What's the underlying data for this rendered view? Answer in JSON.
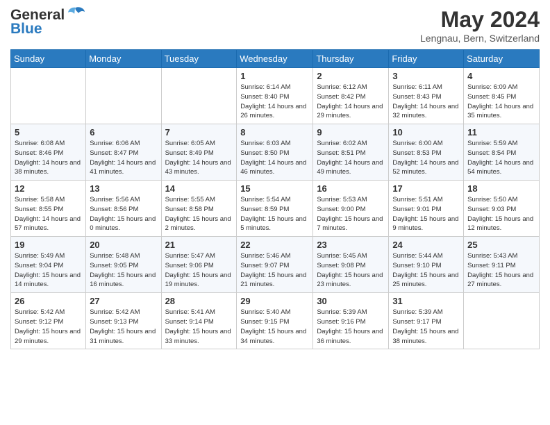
{
  "header": {
    "logo_general": "General",
    "logo_blue": "Blue",
    "month_title": "May 2024",
    "location": "Lengnau, Bern, Switzerland"
  },
  "days_of_week": [
    "Sunday",
    "Monday",
    "Tuesday",
    "Wednesday",
    "Thursday",
    "Friday",
    "Saturday"
  ],
  "weeks": [
    [
      {
        "day": "",
        "sunrise": "",
        "sunset": "",
        "daylight": ""
      },
      {
        "day": "",
        "sunrise": "",
        "sunset": "",
        "daylight": ""
      },
      {
        "day": "",
        "sunrise": "",
        "sunset": "",
        "daylight": ""
      },
      {
        "day": "1",
        "sunrise": "Sunrise: 6:14 AM",
        "sunset": "Sunset: 8:40 PM",
        "daylight": "Daylight: 14 hours and 26 minutes."
      },
      {
        "day": "2",
        "sunrise": "Sunrise: 6:12 AM",
        "sunset": "Sunset: 8:42 PM",
        "daylight": "Daylight: 14 hours and 29 minutes."
      },
      {
        "day": "3",
        "sunrise": "Sunrise: 6:11 AM",
        "sunset": "Sunset: 8:43 PM",
        "daylight": "Daylight: 14 hours and 32 minutes."
      },
      {
        "day": "4",
        "sunrise": "Sunrise: 6:09 AM",
        "sunset": "Sunset: 8:45 PM",
        "daylight": "Daylight: 14 hours and 35 minutes."
      }
    ],
    [
      {
        "day": "5",
        "sunrise": "Sunrise: 6:08 AM",
        "sunset": "Sunset: 8:46 PM",
        "daylight": "Daylight: 14 hours and 38 minutes."
      },
      {
        "day": "6",
        "sunrise": "Sunrise: 6:06 AM",
        "sunset": "Sunset: 8:47 PM",
        "daylight": "Daylight: 14 hours and 41 minutes."
      },
      {
        "day": "7",
        "sunrise": "Sunrise: 6:05 AM",
        "sunset": "Sunset: 8:49 PM",
        "daylight": "Daylight: 14 hours and 43 minutes."
      },
      {
        "day": "8",
        "sunrise": "Sunrise: 6:03 AM",
        "sunset": "Sunset: 8:50 PM",
        "daylight": "Daylight: 14 hours and 46 minutes."
      },
      {
        "day": "9",
        "sunrise": "Sunrise: 6:02 AM",
        "sunset": "Sunset: 8:51 PM",
        "daylight": "Daylight: 14 hours and 49 minutes."
      },
      {
        "day": "10",
        "sunrise": "Sunrise: 6:00 AM",
        "sunset": "Sunset: 8:53 PM",
        "daylight": "Daylight: 14 hours and 52 minutes."
      },
      {
        "day": "11",
        "sunrise": "Sunrise: 5:59 AM",
        "sunset": "Sunset: 8:54 PM",
        "daylight": "Daylight: 14 hours and 54 minutes."
      }
    ],
    [
      {
        "day": "12",
        "sunrise": "Sunrise: 5:58 AM",
        "sunset": "Sunset: 8:55 PM",
        "daylight": "Daylight: 14 hours and 57 minutes."
      },
      {
        "day": "13",
        "sunrise": "Sunrise: 5:56 AM",
        "sunset": "Sunset: 8:56 PM",
        "daylight": "Daylight: 15 hours and 0 minutes."
      },
      {
        "day": "14",
        "sunrise": "Sunrise: 5:55 AM",
        "sunset": "Sunset: 8:58 PM",
        "daylight": "Daylight: 15 hours and 2 minutes."
      },
      {
        "day": "15",
        "sunrise": "Sunrise: 5:54 AM",
        "sunset": "Sunset: 8:59 PM",
        "daylight": "Daylight: 15 hours and 5 minutes."
      },
      {
        "day": "16",
        "sunrise": "Sunrise: 5:53 AM",
        "sunset": "Sunset: 9:00 PM",
        "daylight": "Daylight: 15 hours and 7 minutes."
      },
      {
        "day": "17",
        "sunrise": "Sunrise: 5:51 AM",
        "sunset": "Sunset: 9:01 PM",
        "daylight": "Daylight: 15 hours and 9 minutes."
      },
      {
        "day": "18",
        "sunrise": "Sunrise: 5:50 AM",
        "sunset": "Sunset: 9:03 PM",
        "daylight": "Daylight: 15 hours and 12 minutes."
      }
    ],
    [
      {
        "day": "19",
        "sunrise": "Sunrise: 5:49 AM",
        "sunset": "Sunset: 9:04 PM",
        "daylight": "Daylight: 15 hours and 14 minutes."
      },
      {
        "day": "20",
        "sunrise": "Sunrise: 5:48 AM",
        "sunset": "Sunset: 9:05 PM",
        "daylight": "Daylight: 15 hours and 16 minutes."
      },
      {
        "day": "21",
        "sunrise": "Sunrise: 5:47 AM",
        "sunset": "Sunset: 9:06 PM",
        "daylight": "Daylight: 15 hours and 19 minutes."
      },
      {
        "day": "22",
        "sunrise": "Sunrise: 5:46 AM",
        "sunset": "Sunset: 9:07 PM",
        "daylight": "Daylight: 15 hours and 21 minutes."
      },
      {
        "day": "23",
        "sunrise": "Sunrise: 5:45 AM",
        "sunset": "Sunset: 9:08 PM",
        "daylight": "Daylight: 15 hours and 23 minutes."
      },
      {
        "day": "24",
        "sunrise": "Sunrise: 5:44 AM",
        "sunset": "Sunset: 9:10 PM",
        "daylight": "Daylight: 15 hours and 25 minutes."
      },
      {
        "day": "25",
        "sunrise": "Sunrise: 5:43 AM",
        "sunset": "Sunset: 9:11 PM",
        "daylight": "Daylight: 15 hours and 27 minutes."
      }
    ],
    [
      {
        "day": "26",
        "sunrise": "Sunrise: 5:42 AM",
        "sunset": "Sunset: 9:12 PM",
        "daylight": "Daylight: 15 hours and 29 minutes."
      },
      {
        "day": "27",
        "sunrise": "Sunrise: 5:42 AM",
        "sunset": "Sunset: 9:13 PM",
        "daylight": "Daylight: 15 hours and 31 minutes."
      },
      {
        "day": "28",
        "sunrise": "Sunrise: 5:41 AM",
        "sunset": "Sunset: 9:14 PM",
        "daylight": "Daylight: 15 hours and 33 minutes."
      },
      {
        "day": "29",
        "sunrise": "Sunrise: 5:40 AM",
        "sunset": "Sunset: 9:15 PM",
        "daylight": "Daylight: 15 hours and 34 minutes."
      },
      {
        "day": "30",
        "sunrise": "Sunrise: 5:39 AM",
        "sunset": "Sunset: 9:16 PM",
        "daylight": "Daylight: 15 hours and 36 minutes."
      },
      {
        "day": "31",
        "sunrise": "Sunrise: 5:39 AM",
        "sunset": "Sunset: 9:17 PM",
        "daylight": "Daylight: 15 hours and 38 minutes."
      },
      {
        "day": "",
        "sunrise": "",
        "sunset": "",
        "daylight": ""
      }
    ]
  ]
}
